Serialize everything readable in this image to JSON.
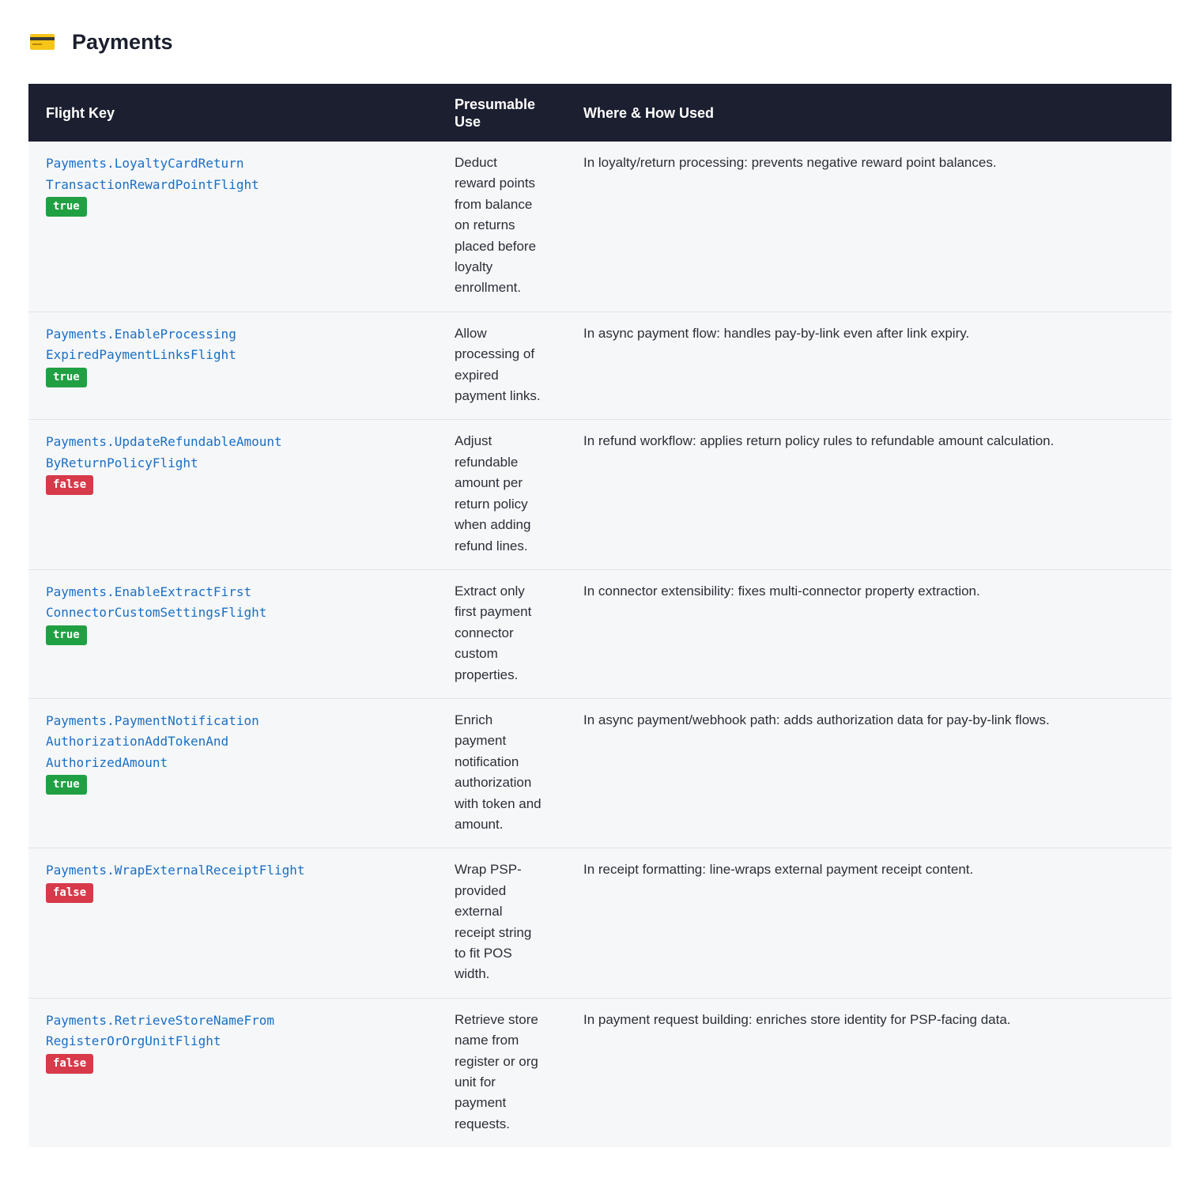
{
  "section": {
    "icon": "credit-card-icon",
    "title": "Payments"
  },
  "table": {
    "headers": {
      "flight_key": "Flight Key",
      "use_line1": "Presumable",
      "use_line2": "Use",
      "where": "Where & How Used"
    },
    "rows": [
      {
        "key_lines": [
          "Payments.LoyaltyCardReturn",
          "TransactionRewardPointFlight"
        ],
        "badge": "true",
        "use": "Deduct reward points from balance on returns placed before loyalty enrollment.",
        "where": "In loyalty/return processing: prevents negative reward point balances."
      },
      {
        "key_lines": [
          "Payments.EnableProcessing",
          "ExpiredPaymentLinksFlight"
        ],
        "badge": "true",
        "use": "Allow processing of expired payment links.",
        "where": "In async payment flow: handles pay-by-link even after link expiry."
      },
      {
        "key_lines": [
          "Payments.UpdateRefundableAmount",
          "ByReturnPolicyFlight"
        ],
        "badge": "false",
        "use": "Adjust refundable amount per return policy when adding refund lines.",
        "where": "In refund workflow: applies return policy rules to refundable amount calculation."
      },
      {
        "key_lines": [
          "Payments.EnableExtractFirst",
          "ConnectorCustomSettingsFlight"
        ],
        "badge": "true",
        "use": "Extract only first payment connector custom properties.",
        "where": "In connector extensibility: fixes multi-connector property extraction."
      },
      {
        "key_lines": [
          "Payments.PaymentNotification",
          "AuthorizationAddTokenAnd",
          "AuthorizedAmount"
        ],
        "badge": "true",
        "use": "Enrich payment notification authorization with token and amount.",
        "where": "In async payment/webhook path: adds authorization data for pay-by-link flows."
      },
      {
        "key_lines": [
          "Payments.WrapExternalReceiptFlight"
        ],
        "badge": "false",
        "use": "Wrap PSP-provided external receipt string to fit POS width.",
        "where": "In receipt formatting: line-wraps external payment receipt content."
      },
      {
        "key_lines": [
          "Payments.RetrieveStoreNameFrom",
          "RegisterOrOrgUnitFlight"
        ],
        "badge": "false",
        "use": "Retrieve store name from register or org unit for payment requests.",
        "where": "In payment request building: enriches store identity for PSP-facing data."
      }
    ]
  }
}
